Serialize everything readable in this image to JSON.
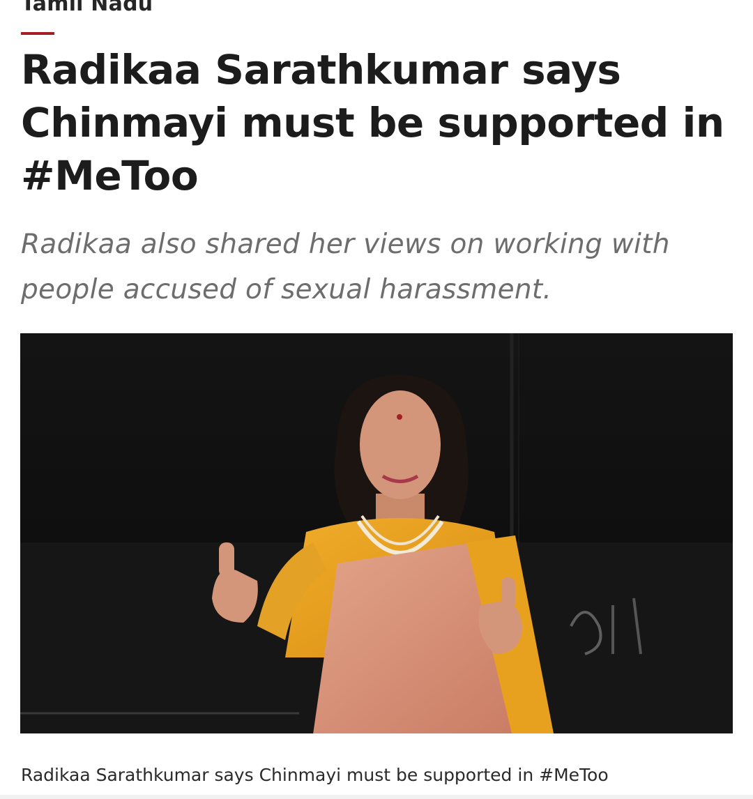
{
  "article": {
    "category": "Tamil Nadu",
    "headline": "Radikaa Sarathkumar says Chinmayi must be supported in #MeToo",
    "subheadline": "Radikaa also shared her views on working with people accused of sexual harassment.",
    "image_caption": "Radikaa Sarathkumar says Chinmayi must be supported in #MeToo"
  },
  "colors": {
    "accent": "#a31f24",
    "headline_text": "#1c1c1c",
    "subheadline_text": "#6d6d6d",
    "photo_background": "#0e0e0e",
    "saree": "#e8a11f"
  }
}
